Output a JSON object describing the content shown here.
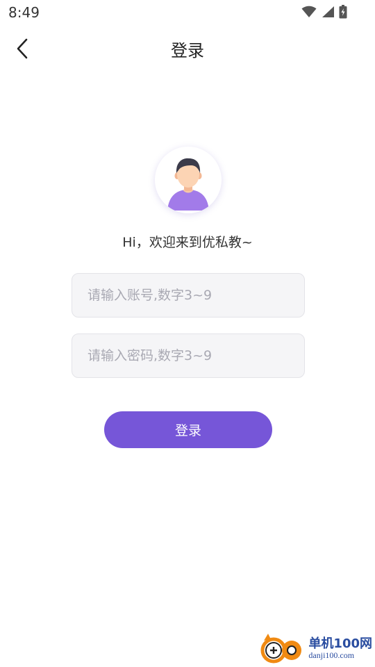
{
  "status_bar": {
    "time": "8:49"
  },
  "header": {
    "title": "登录"
  },
  "greeting": "Hi，欢迎来到优私教~",
  "form": {
    "account_placeholder": "请输入账号,数字3~9",
    "password_placeholder": "请输入密码,数字3~9",
    "submit_label": "登录"
  },
  "watermark": {
    "name": "单机100网",
    "url": "danji100.com"
  },
  "colors": {
    "accent": "#7656d8",
    "input_bg": "#f5f5f7",
    "avatar_shirt": "#a27be9"
  }
}
